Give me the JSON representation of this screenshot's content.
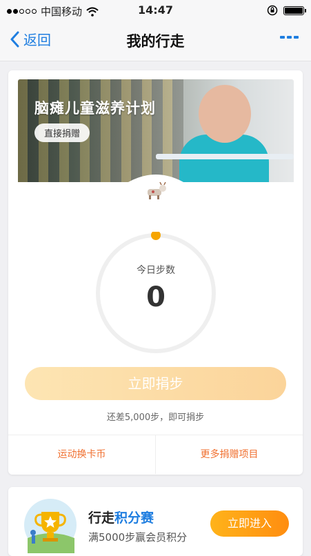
{
  "status_bar": {
    "carrier": "中国移动",
    "time": "14:47"
  },
  "nav": {
    "back_label": "返回",
    "title": "我的行走"
  },
  "banner": {
    "title": "脑瘫儿童滋养计划",
    "donate_label": "直接捐赠"
  },
  "steps": {
    "label": "今日步数",
    "value": "0",
    "progress": 0
  },
  "donate_steps_label": "立即捐步",
  "hint": "还差5,000步，即可捐步",
  "footer": {
    "left_link": "运动换卡币",
    "right_link": "更多捐赠项目"
  },
  "contest": {
    "title_prefix": "行走",
    "title_accent": "积分赛",
    "subtitle": "满5000步赢会员积分",
    "enter_label": "立即进入"
  },
  "colors": {
    "accent_blue": "#1f7ee0",
    "accent_orange": "#f07030",
    "ring_dot": "#f6a500"
  }
}
